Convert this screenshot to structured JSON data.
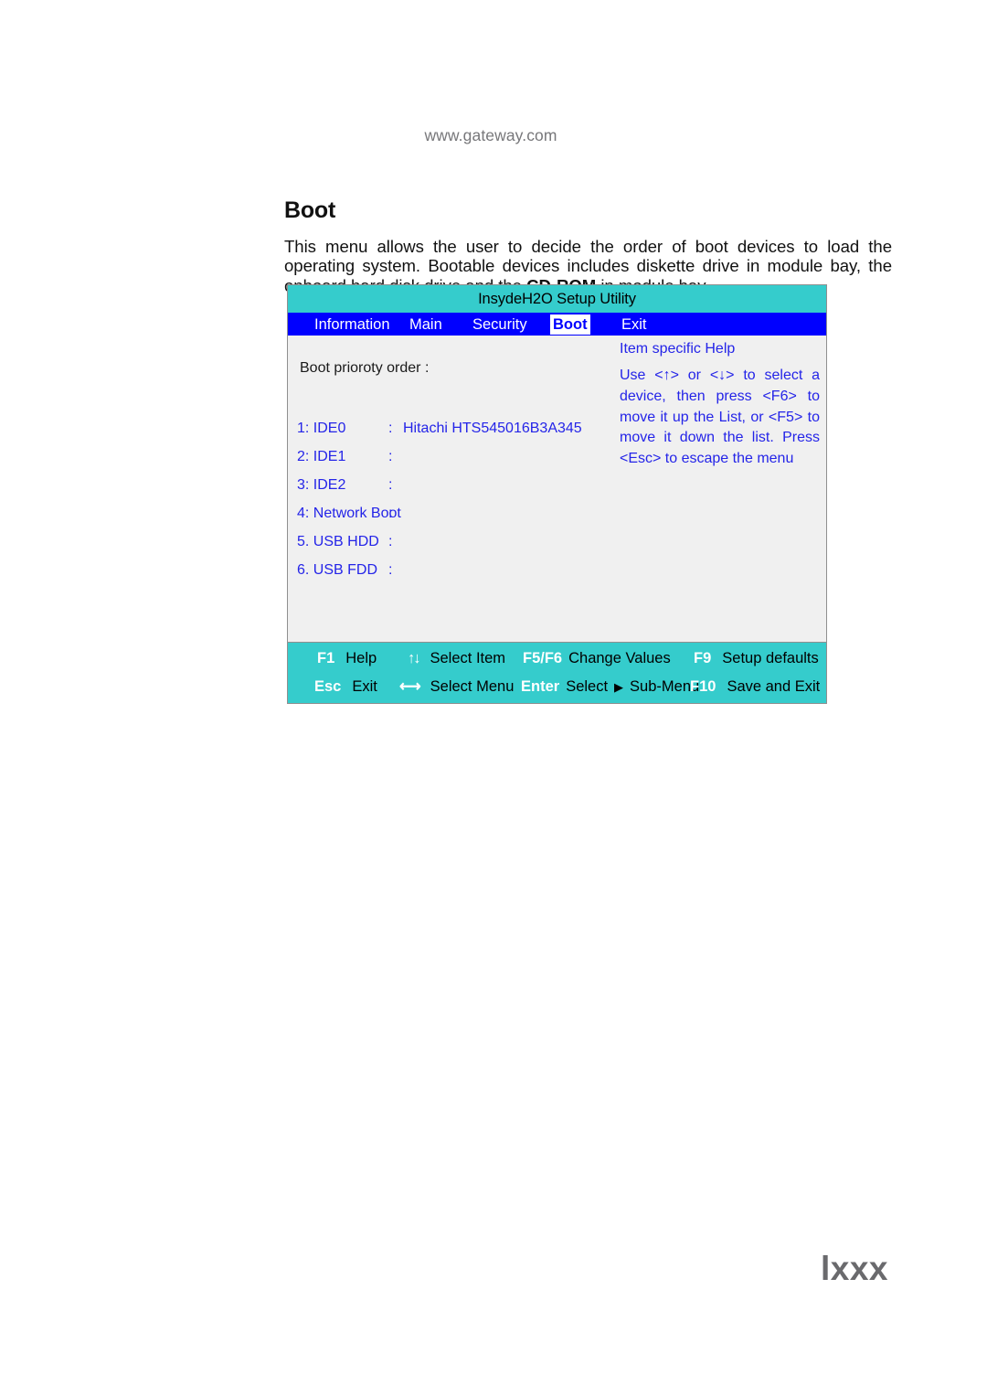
{
  "page": {
    "site_url": "www.gateway.com",
    "page_number": "lxxx",
    "heading": "Boot",
    "intro_part1": "This menu allows the user to decide the order of boot devices to load the operating system. Bootable devices includes diskette drive in module bay, the onboard hard disk drive and the ",
    "intro_bold": "CD-ROM",
    "intro_part2": " in module bay."
  },
  "bios": {
    "title": "InsydeH2O Setup Utility",
    "menu_tabs": [
      {
        "label": "Information",
        "selected": false
      },
      {
        "label": "Main",
        "selected": false
      },
      {
        "label": "Security",
        "selected": false
      },
      {
        "label": "Boot",
        "selected": true
      },
      {
        "label": "Exit",
        "selected": false
      }
    ],
    "boot_order_label": "Boot prioroty order :",
    "boot_items": [
      {
        "index": "1: IDE0",
        "separator": ":",
        "value": "Hitachi HTS545016B3A345"
      },
      {
        "index": "2: IDE1",
        "separator": ":",
        "value": ""
      },
      {
        "index": "3: IDE2",
        "separator": ":",
        "value": ""
      },
      {
        "index": "4: Network Boot",
        "separator": ":",
        "value": ""
      },
      {
        "index": "5. USB HDD",
        "separator": ":",
        "value": ""
      },
      {
        "index": "6. USB FDD",
        "separator": ":",
        "value": ""
      }
    ],
    "help": {
      "title": "Item specific Help",
      "text": "Use <↑> or <↓> to select a device, then press <F6> to move it up the List, or <F5> to move it down the list. Press <Esc> to escape the menu"
    },
    "footer_keys": [
      {
        "key": "F1",
        "glyph": "",
        "label": "Help"
      },
      {
        "key": "",
        "glyph": "↑↓",
        "label": "Select Item"
      },
      {
        "key": "F5/F6",
        "glyph": "",
        "label": "Change Values"
      },
      {
        "key": "F9",
        "glyph": "",
        "label": "Setup defaults"
      },
      {
        "key": "Esc",
        "glyph": "",
        "label": "Exit"
      },
      {
        "key": "",
        "glyph": "⟷",
        "label": "Select Menu"
      },
      {
        "key": "Enter",
        "glyph": "",
        "label": "Select",
        "label2": "Sub-Menu",
        "triangle": "▶"
      },
      {
        "key": "F10",
        "glyph": "",
        "label": "Save and Exit"
      }
    ],
    "colors": {
      "titlebar_teal": "#35cccc",
      "menubar_blue": "#0000ff",
      "body_gray": "#f0f0f0",
      "text_blue": "#2424e8"
    }
  }
}
